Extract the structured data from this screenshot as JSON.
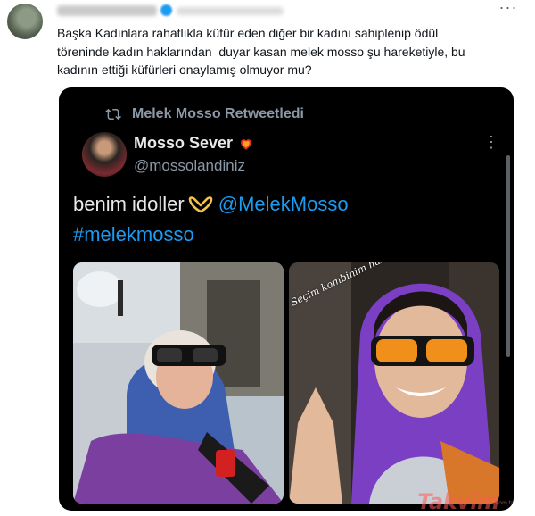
{
  "tweet": {
    "text": "Başka Kadınlara rahatlıkla küfür eden diğer bir kadını sahiplenip ödül\ntöreninde kadın haklarından  duyar kasan melek mosso şu hareketiyle, bu\nkadının ettiği küfürleri onaylamış olmuyor mu?",
    "more_label": "···"
  },
  "embed": {
    "retweet_label": "Melek Mosso Retweetledi",
    "author_name": "Mosso Sever",
    "author_handle": "@mossolandiniz",
    "more_label": "⋮",
    "text_prefix": "benim idoller",
    "mention": "@MelekMosso",
    "hashtag": "#melekmosso",
    "photo_caption": "Seçim kombinim hazır",
    "icons": [
      "retweet-icon",
      "heart-emoji-icon",
      "heart-hands-emoji-icon"
    ]
  },
  "watermark": "Takvim",
  "watermark_sub": "com.tr",
  "colors": {
    "link": "#1d9bf0",
    "embed_bg": "#000000",
    "muted": "#8b98a5"
  }
}
